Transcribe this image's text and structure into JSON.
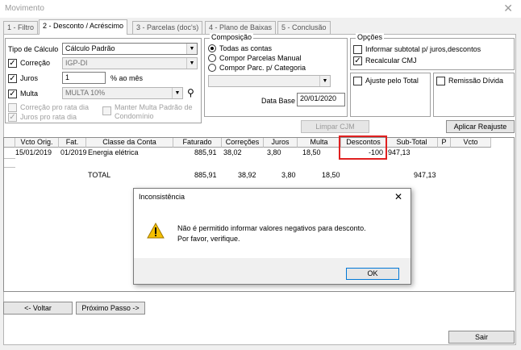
{
  "window": {
    "title": "Movimento",
    "close_glyph": "✕"
  },
  "tabs": [
    {
      "label": "1 - Filtro"
    },
    {
      "label": "2 - Desconto / Acréscimo"
    },
    {
      "label": "3 - Parcelas (doc's)"
    },
    {
      "label": "4 - Plano de Baixas"
    },
    {
      "label": "5 - Conclusão"
    }
  ],
  "calc": {
    "tipo_label": "Tipo de Cálculo",
    "tipo_value": "Cálculo Padrão",
    "correcao_label": "Correção",
    "correcao_checked": true,
    "correcao_value": "IGP-DI",
    "juros_label": "Juros",
    "juros_checked": true,
    "juros_value": "1",
    "juros_unit": "% ao mês",
    "multa_label": "Multa",
    "multa_checked": true,
    "multa_value": "MULTA 10%",
    "correcao_pro_rata": "Correção pro rata dia",
    "juros_pro_rata": "Juros pro rata dia",
    "manter_multa": "Manter Multa Padrão de Condomínio"
  },
  "composicao": {
    "title": "Composição",
    "options": [
      "Todas as contas",
      "Compor Parcelas Manual",
      "Compor Parc. p/ Categoria"
    ],
    "selected_index": 0,
    "data_base_label": "Data Base",
    "data_base_value": "20/01/2020",
    "limpar_label": "Limpar CJM"
  },
  "opcoes": {
    "title": "Opções",
    "informar_subtotal": "Informar subtotal p/ juros,descontos",
    "informar_checked": false,
    "recalcular": "Recalcular CMJ",
    "recalcular_checked": true,
    "ajuste": "Ajuste pelo Total",
    "remissao": "Remissão Dívida",
    "aplicar_label": "Aplicar Reajuste"
  },
  "grid": {
    "columns": [
      "Vcto Orig.",
      "Fat.",
      "Classe da Conta",
      "Faturado",
      "Correções",
      "Juros",
      "Multa",
      "Descontos",
      "Sub-Total",
      "P",
      "Vcto"
    ],
    "rows": [
      {
        "vcto_orig": "15/01/2019",
        "fat": "01/2019",
        "classe": "Energia elétrica",
        "faturado": "885,91",
        "correcoes": "38,02",
        "juros": "3,80",
        "multa": "18,50",
        "descontos": "-100",
        "subtotal": "947,13"
      }
    ],
    "total": {
      "label": "TOTAL",
      "faturado": "885,91",
      "correcoes": "38,92",
      "juros": "3,80",
      "multa": "18,50",
      "subtotal": "947,13"
    }
  },
  "dialog": {
    "title": "Inconsistência",
    "close_glyph": "✕",
    "line1": "Não é permitido informar valores negativos para desconto.",
    "line2": "Por favor, verifique.",
    "ok_label": "OK",
    "icon": "warning-icon"
  },
  "footer": {
    "voltar_label": "<- Voltar",
    "proximo_label": "Próximo Passo ->",
    "sair_label": "Sair"
  },
  "colors": {
    "highlight": "#e02020",
    "warning": "#f5c000"
  }
}
